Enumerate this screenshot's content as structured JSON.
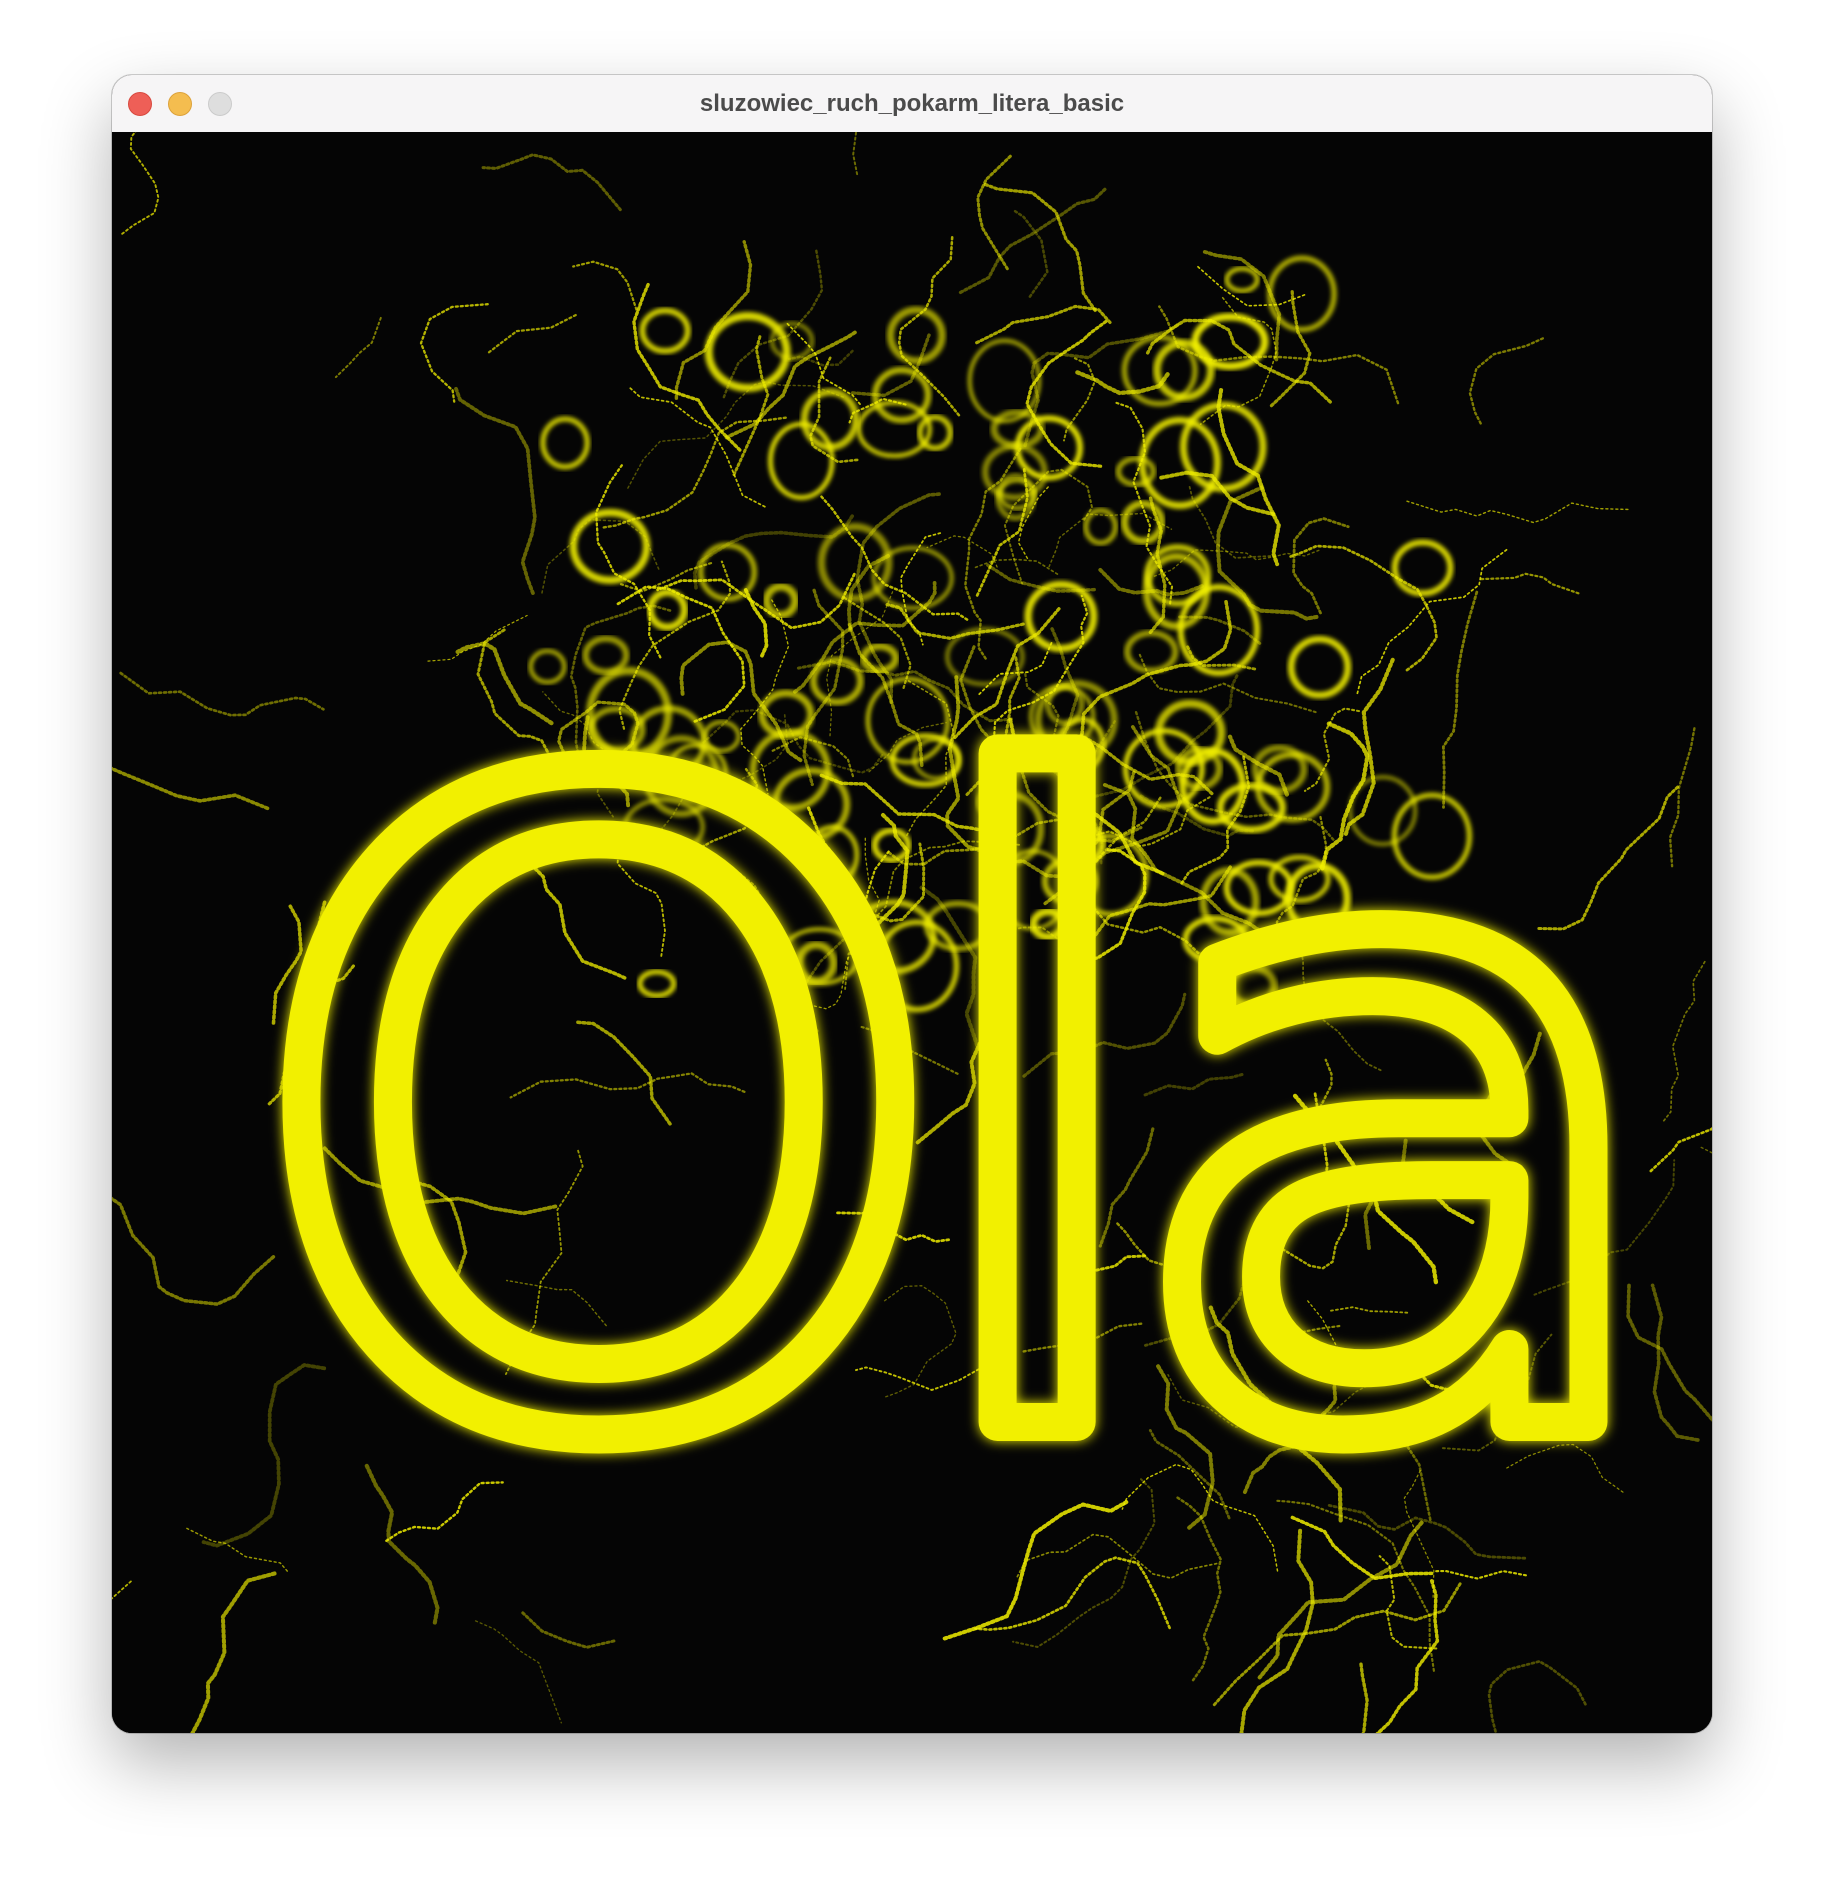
{
  "window": {
    "title": "sluzowiec_ruch_pokarm_litera_basic"
  },
  "canvas": {
    "text": "Ola",
    "background_color": "#050505",
    "slime_color": "#f2f000"
  },
  "icons": {
    "close": "close-traffic-light-icon",
    "minimize": "minimize-traffic-light-icon",
    "maximize": "maximize-traffic-light-icon"
  }
}
